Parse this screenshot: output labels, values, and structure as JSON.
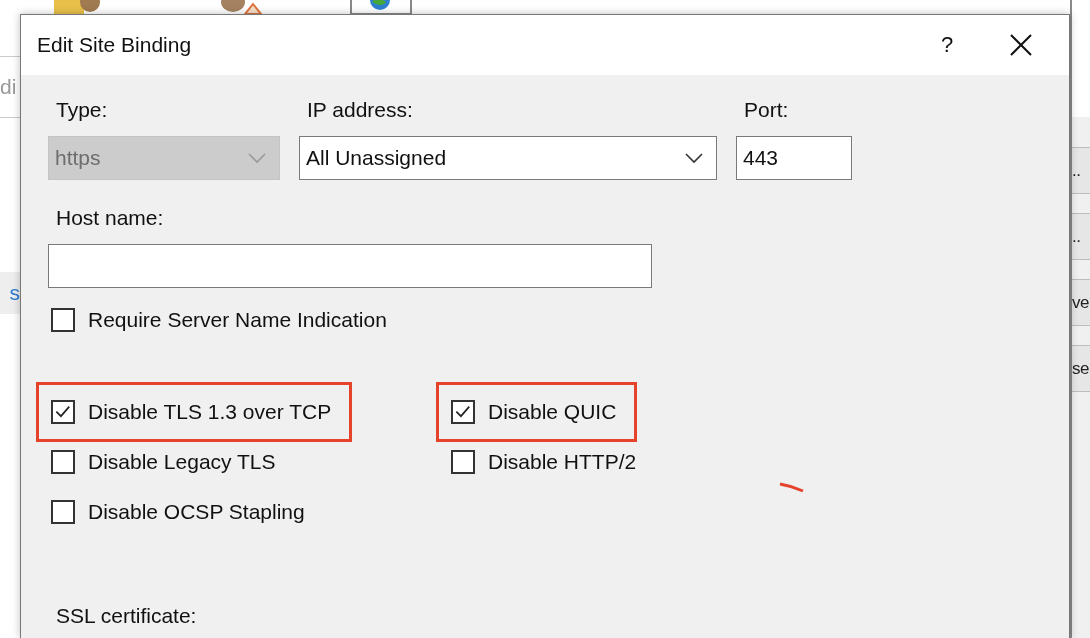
{
  "background": {
    "left_texts": [
      "di",
      "s"
    ],
    "right_buttons": [
      "..",
      "..",
      "ve",
      "se"
    ]
  },
  "dialog": {
    "title": "Edit Site Binding",
    "help": "?"
  },
  "type": {
    "label": "Type:",
    "value": "https",
    "disabled": true
  },
  "ip_address": {
    "label": "IP address:",
    "value": "All Unassigned",
    "disabled": false
  },
  "port": {
    "label": "Port:",
    "value": "443"
  },
  "host_name": {
    "label": "Host name:"
  },
  "option_rows": [
    [
      {
        "label": "Require Server Name Indication",
        "checked": false,
        "highlighted": false
      }
    ],
    [
      {
        "label": "Disable TLS 1.3 over TCP",
        "checked": true,
        "highlighted": true
      },
      {
        "label": "Disable QUIC",
        "checked": true,
        "highlighted": true
      }
    ],
    [
      {
        "label": "Disable Legacy TLS",
        "checked": false,
        "highlighted": false
      },
      {
        "label": "Disable HTTP/2",
        "checked": false,
        "highlighted": false
      }
    ],
    [
      {
        "label": "Disable OCSP Stapling",
        "checked": false,
        "highlighted": false
      }
    ]
  ],
  "ssl_certificate": {
    "label": "SSL certificate:"
  }
}
